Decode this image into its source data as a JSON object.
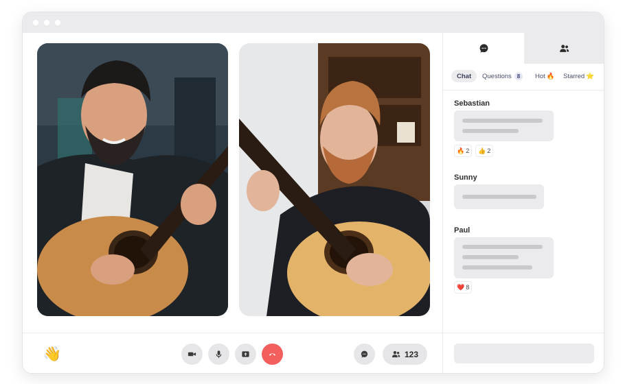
{
  "sidebar": {
    "tabs": [
      {
        "icon": "chat-bubble-icon",
        "active": true
      },
      {
        "icon": "people-icon",
        "active": false
      }
    ],
    "filters": [
      {
        "label": "Chat"
      },
      {
        "label": "Questions",
        "count": "8"
      },
      {
        "label": "Hot",
        "emoji": "🔥"
      },
      {
        "label": "Starred",
        "emoji": "⭐"
      }
    ],
    "messages": [
      {
        "author": "Sebastian",
        "reactions": [
          {
            "emoji": "🔥",
            "count": "2"
          },
          {
            "emoji": "👍",
            "count": "2"
          }
        ]
      },
      {
        "author": "Sunny",
        "reactions": []
      },
      {
        "author": "Paul",
        "reactions": [
          {
            "emoji": "❤️",
            "count": "8"
          }
        ]
      }
    ]
  },
  "controls": {
    "participants_count": "123",
    "wave_emoji": "👋"
  },
  "colors": {
    "end_call": "#f25f5c",
    "button_bg": "#e6e6e8",
    "titlebar": "#ebebed"
  }
}
